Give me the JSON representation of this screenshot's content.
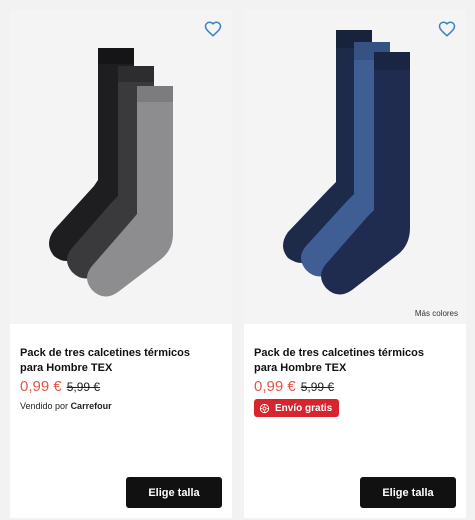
{
  "products": [
    {
      "title": "Pack de tres calcetines térmicos para Hombre TEX",
      "price_new": "0,99 €",
      "price_old": "5,99 €",
      "seller_prefix": "Vendido por",
      "seller_name": "Carrefour",
      "button_label": "Elige talla",
      "sock_colors": [
        "#1e1e20",
        "#3a3a3c",
        "#8d8d8f"
      ],
      "icons": [
        "heart-icon"
      ]
    },
    {
      "title": "Pack de tres calcetines térmicos para Hombre TEX",
      "price_new": "0,99 €",
      "price_old": "5,99 €",
      "badge_label": "Envío gratis",
      "more_colors": "Más colores",
      "button_label": "Elige talla",
      "sock_colors": [
        "#1d2a4a",
        "#3f5f94",
        "#202c4f"
      ],
      "icons": [
        "heart-icon",
        "truck-badge-icon"
      ]
    }
  ],
  "colors": {
    "accent_price": "#e0564a",
    "badge_bg": "#d8242d",
    "button_bg": "#111111",
    "heart": "#3b82c4"
  }
}
